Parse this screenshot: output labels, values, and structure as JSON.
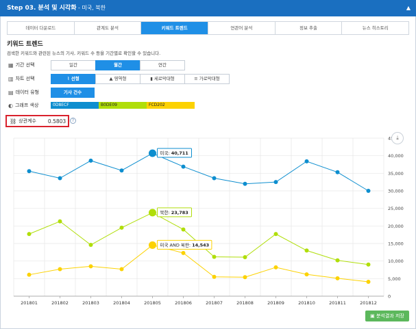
{
  "header": {
    "title": "Step 03. 분석 및 시각화",
    "subtitle": " - 미국, 북한",
    "collapse_icon": "chevron-up-icon"
  },
  "tabs": [
    {
      "label": "데이터 다운로드",
      "active": false
    },
    {
      "label": "관계도 분석",
      "active": false
    },
    {
      "label": "키워드 트렌드",
      "active": true
    },
    {
      "label": "연관어 분석",
      "active": false
    },
    {
      "label": "정보 추출",
      "active": false
    },
    {
      "label": "뉴스 히스토리",
      "active": false
    }
  ],
  "section": {
    "title": "키워드 트렌드",
    "description": "검색한 키워드와 관련된 뉴스의 기사, 키워드 수 등을 기간별로 확인할 수 있습니다."
  },
  "period": {
    "label": "기간 선택",
    "icon": "calendar-icon",
    "options": [
      "일간",
      "월간",
      "연간"
    ],
    "selected": "월간"
  },
  "chart_type": {
    "label": "차트 선택",
    "icon": "chart-icon",
    "options": [
      "선형",
      "영역형",
      "세로막대형",
      "가로막대형"
    ],
    "selected": "선형"
  },
  "data_type": {
    "label": "데이터 유형",
    "icon": "table-icon",
    "options": [
      "기사 건수"
    ],
    "selected": "기사 건수"
  },
  "graph_color": {
    "label": "그래프 색상",
    "icon": "palette-icon",
    "colors": [
      "0D8ECF",
      "B0DE09",
      "FCD202"
    ]
  },
  "correlation": {
    "label": "상관계수",
    "icon": "link-icon",
    "value": "0.5803",
    "help_icon": "?"
  },
  "download_icon": "download-icon",
  "save_button": {
    "icon": "save-icon",
    "label": "분석결과 저장"
  },
  "chart_data": {
    "type": "line",
    "categories": [
      "201801",
      "201802",
      "201803",
      "201804",
      "201805",
      "201806",
      "201807",
      "201808",
      "201809",
      "201810",
      "201811",
      "201812"
    ],
    "ylim": [
      0,
      45000
    ],
    "yticks": [
      0,
      5000,
      10000,
      15000,
      20000,
      25000,
      30000,
      35000,
      40000,
      45000
    ],
    "ytick_labels": [
      "0",
      "5,000",
      "10,000",
      "15,000",
      "20,000",
      "25,000",
      "30,000",
      "35,000",
      "40,000",
      "45"
    ],
    "grid": true,
    "series": [
      {
        "name": "미국",
        "color": "#0D8ECF",
        "values": [
          35600,
          33600,
          38600,
          35800,
          40711,
          36900,
          33600,
          32000,
          32500,
          38400,
          35300,
          30000
        ]
      },
      {
        "name": "북한",
        "color": "#B0DE09",
        "values": [
          17700,
          21300,
          14600,
          19500,
          23783,
          19000,
          11200,
          11100,
          17700,
          13000,
          10200,
          9000
        ]
      },
      {
        "name": "미국 AND 북한",
        "color": "#FCD202",
        "values": [
          6100,
          7700,
          8500,
          7700,
          14543,
          12300,
          5500,
          5400,
          8200,
          6200,
          5100,
          4100
        ]
      }
    ],
    "tooltips": [
      {
        "series": 0,
        "index": 4,
        "label": "미국: ",
        "value": "40,711"
      },
      {
        "series": 1,
        "index": 4,
        "label": "북한: ",
        "value": "23,783"
      },
      {
        "series": 2,
        "index": 4,
        "label": "미국 AND 북한: ",
        "value": "14,543"
      }
    ]
  }
}
